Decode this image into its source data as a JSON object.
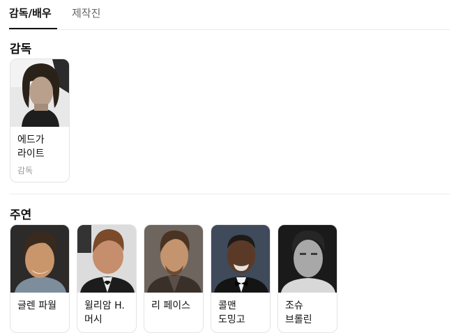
{
  "tabs": [
    {
      "label": "감독/배우",
      "active": true
    },
    {
      "label": "제작진",
      "active": false
    }
  ],
  "directors": {
    "title": "감독",
    "people": [
      {
        "name": "에드가 라이트",
        "role": "감독"
      }
    ]
  },
  "cast": {
    "title": "주연",
    "people": [
      {
        "name": "글렌 파월"
      },
      {
        "name": "윌리암 H. 머시"
      },
      {
        "name": "리 페이스"
      },
      {
        "name": "콜맨 도밍고"
      },
      {
        "name": "조슈 브롤린"
      }
    ]
  },
  "colors": {
    "text": "#111111",
    "subtext": "#999999",
    "tab_inactive": "#666666",
    "divider": "#ebebeb",
    "card_border": "#e3e3e3"
  }
}
